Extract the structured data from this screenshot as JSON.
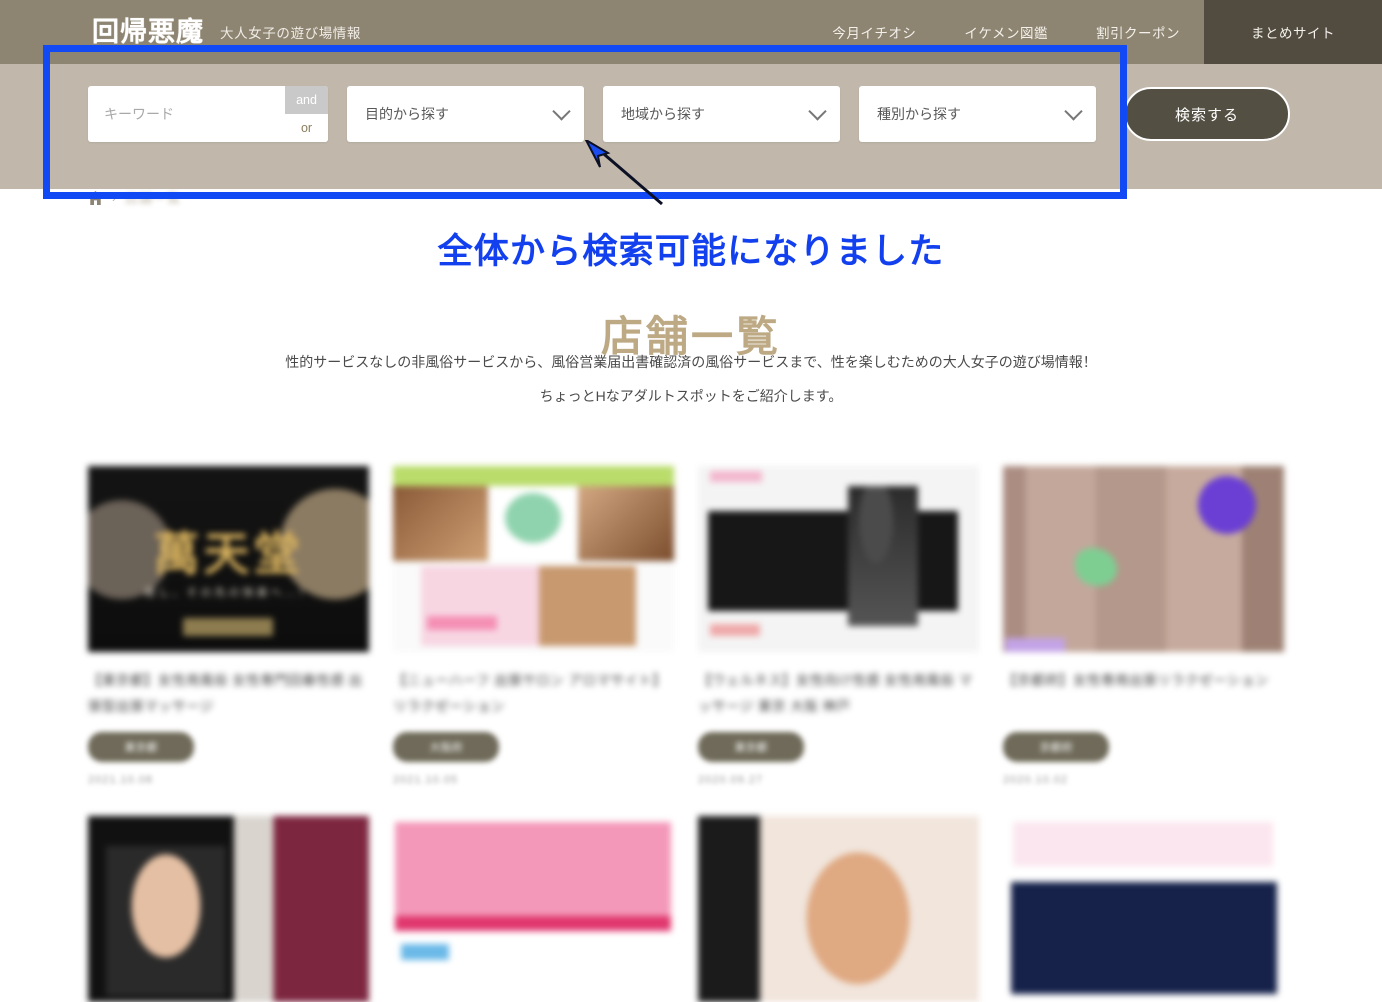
{
  "header": {
    "logo_text": "回帰悪魔",
    "tagline": "大人女子の遊び場情報",
    "nav": [
      {
        "label": "今月イチオシ",
        "active": false
      },
      {
        "label": "イケメン図鑑",
        "active": false
      },
      {
        "label": "割引クーポン",
        "active": false
      },
      {
        "label": "まとめサイト",
        "active": true
      }
    ]
  },
  "search": {
    "keyword_placeholder": "キーワード",
    "keyword_value": "",
    "and_label": "and",
    "or_label": "or",
    "selects": [
      {
        "label": "目的から探す"
      },
      {
        "label": "地域から探す"
      },
      {
        "label": "種別から探す"
      }
    ],
    "submit_label": "検索する"
  },
  "breadcrumb": {
    "home_icon": "home-icon",
    "separator": "›",
    "current": "店舗一覧"
  },
  "annotation": {
    "text": "全体から検索可能になりました",
    "color": "#1340ef",
    "arrow": "arrow-up-left"
  },
  "page": {
    "title": "店舗一覧",
    "title_color": "#bda984",
    "lead_line1": "性的サービスなしの非風俗サービスから、風俗営業届出書確認済の風俗サービスまで、性を楽しむための大人女子の遊び場情報！",
    "lead_line2": "ちょっとHなアダルトスポットをご紹介します。"
  },
  "cards": [
    {
      "thumb_class": "t1",
      "thumb_kanji": "萬天堂",
      "thumb_sub": "癒し、その先の快楽へ…！",
      "title": "【東京都】女性用風俗 女性専門回春性感 出張型出張マッサージ",
      "badge": "東京都",
      "date": "2021.10.08"
    },
    {
      "thumb_class": "t2",
      "thumb_kanji": "",
      "thumb_sub": "",
      "title": "【ニューハーフ 出張サロン アロマサイト】リラクゼーション",
      "badge": "大阪府",
      "date": "2021.10.05"
    },
    {
      "thumb_class": "t3",
      "thumb_kanji": "",
      "thumb_sub": "",
      "title": "【ウェルネス】女性向け性感 女性用風俗 マッサージ 東京 大阪 神戸",
      "badge": "東京都",
      "date": "2020.09.27"
    },
    {
      "thumb_class": "t4",
      "thumb_kanji": "",
      "thumb_sub": "",
      "title": "【京都府】女性専用出張リラクゼーション",
      "badge": "京都府",
      "date": "2020.10.02"
    },
    {
      "thumb_class": "t5",
      "thumb_kanji": "",
      "thumb_sub": "",
      "title": "",
      "badge": "",
      "date": ""
    },
    {
      "thumb_class": "t6",
      "thumb_kanji": "",
      "thumb_sub": "",
      "title": "",
      "badge": "",
      "date": ""
    },
    {
      "thumb_class": "t7",
      "thumb_kanji": "",
      "thumb_sub": "",
      "title": "",
      "badge": "",
      "date": ""
    },
    {
      "thumb_class": "t8",
      "thumb_kanji": "",
      "thumb_sub": "",
      "title": "",
      "badge": "",
      "date": ""
    }
  ]
}
